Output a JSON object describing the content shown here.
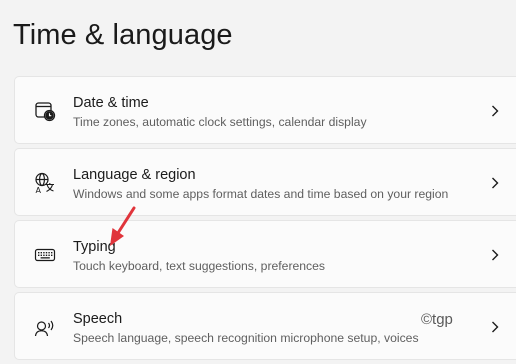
{
  "page": {
    "title": "Time & language"
  },
  "items": [
    {
      "title": "Date & time",
      "description": "Time zones, automatic clock settings, calendar display",
      "icon": "date-time-icon"
    },
    {
      "title": "Language & region",
      "description": "Windows and some apps format dates and time based on your region",
      "icon": "language-icon"
    },
    {
      "title": "Typing",
      "description": "Touch keyboard, text suggestions, preferences",
      "icon": "keyboard-icon"
    },
    {
      "title": "Speech",
      "description": "Speech language, speech recognition microphone setup, voices",
      "icon": "speech-icon"
    }
  ],
  "watermark": "©tgp",
  "colors": {
    "background": "#f3f3f3",
    "card": "#fbfbfb",
    "annotation_arrow": "#e0343b"
  }
}
